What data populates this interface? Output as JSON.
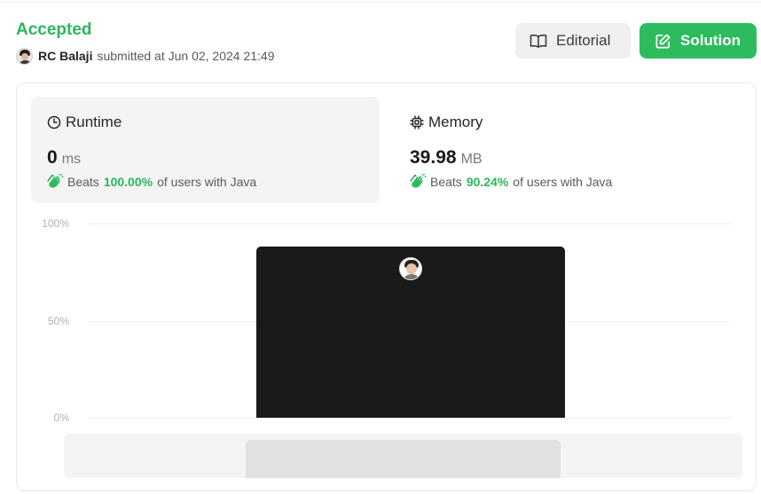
{
  "header": {
    "status": "Accepted",
    "user": "RC Balaji",
    "submitted_text": "submitted at Jun 02, 2024 21:49",
    "editorial_label": "Editorial",
    "solution_label": "Solution",
    "status_color": "#2db55d",
    "solution_color": "#2cbb5d"
  },
  "runtime": {
    "title": "Runtime",
    "value": "0",
    "unit": "ms",
    "beats_label": "Beats",
    "beats_pct": "100.00%",
    "beats_suffix": "of users with Java",
    "icon": "clock-icon"
  },
  "memory": {
    "title": "Memory",
    "value": "39.98",
    "unit": "MB",
    "beats_label": "Beats",
    "beats_pct": "90.24%",
    "beats_suffix": "of users with Java",
    "icon": "chip-icon"
  },
  "chart_data": {
    "type": "bar",
    "y_ticks": [
      "100%",
      "50%",
      "0%"
    ],
    "ylim": [
      0,
      100
    ],
    "values": [
      88
    ],
    "bar_color": "#1a1a1a",
    "grid": true
  }
}
